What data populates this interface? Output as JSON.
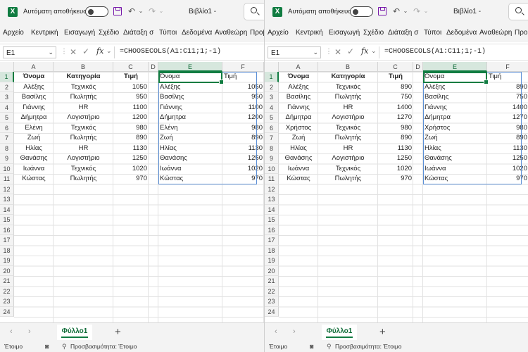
{
  "app": {
    "autosave_label": "Αυτόματη αποθήκευση",
    "doc_title": "Βιβλίο1  -",
    "logo_letter": "X"
  },
  "menu": [
    "Αρχείο",
    "Κεντρική",
    "Εισαγωγή",
    "Σχέδιο",
    "Διάταξη σ",
    "Τύποι",
    "Δεδομένα",
    "Αναθεώρη",
    "Προβ"
  ],
  "formula_bar": {
    "name_box": "E1",
    "formula": "=CHOOSECOLS(A1:C11;1;-1)",
    "fx": "fx"
  },
  "columns": [
    "A",
    "B",
    "C",
    "D",
    "E",
    "F"
  ],
  "rows": [
    "1",
    "2",
    "3",
    "4",
    "5",
    "6",
    "7",
    "8",
    "9",
    "10",
    "11",
    "12",
    "13",
    "14",
    "15",
    "16",
    "17",
    "18",
    "19",
    "20",
    "21",
    "22",
    "23",
    "24"
  ],
  "windows": [
    {
      "headers": [
        "Όνομα",
        "Κατηγορία",
        "Τιμή"
      ],
      "source": [
        [
          "Αλέξης",
          "Τεχνικός",
          "1050"
        ],
        [
          "Βασίλης",
          "Πωλητής",
          "950"
        ],
        [
          "Γιάννης",
          "HR",
          "1100"
        ],
        [
          "Δήμητρα",
          "Λογιστήριο",
          "1200"
        ],
        [
          "Ελένη",
          "Τεχνικός",
          "980"
        ],
        [
          "Ζωή",
          "Πωλητής",
          "890"
        ],
        [
          "Ηλίας",
          "HR",
          "1130"
        ],
        [
          "Θανάσης",
          "Λογιστήριο",
          "1250"
        ],
        [
          "Ιωάννα",
          "Τεχνικός",
          "1020"
        ],
        [
          "Κώστας",
          "Πωλητής",
          "970"
        ]
      ],
      "result_headers": [
        "Όνομα",
        "Τιμή"
      ],
      "result": [
        [
          "Αλέξης",
          "1050"
        ],
        [
          "Βασίλης",
          "950"
        ],
        [
          "Γιάννης",
          "1100"
        ],
        [
          "Δήμητρα",
          "1200"
        ],
        [
          "Ελένη",
          "980"
        ],
        [
          "Ζωή",
          "890"
        ],
        [
          "Ηλίας",
          "1130"
        ],
        [
          "Θανάσης",
          "1250"
        ],
        [
          "Ιωάννα",
          "1020"
        ],
        [
          "Κώστας",
          "970"
        ]
      ]
    },
    {
      "headers": [
        "Όνομα",
        "Κατηγορία",
        "Τιμή"
      ],
      "source": [
        [
          "Αλέξης",
          "Τεχνικός",
          "890"
        ],
        [
          "Βασίλης",
          "Πωλητής",
          "750"
        ],
        [
          "Γιάννης",
          "HR",
          "1400"
        ],
        [
          "Δήμητρα",
          "Λογιστήριο",
          "1270"
        ],
        [
          "Χρήστος",
          "Τεχνικός",
          "980"
        ],
        [
          "Ζωή",
          "Πωλητής",
          "890"
        ],
        [
          "Ηλίας",
          "HR",
          "1130"
        ],
        [
          "Θανάσης",
          "Λογιστήριο",
          "1250"
        ],
        [
          "Ιωάννα",
          "Τεχνικός",
          "1020"
        ],
        [
          "Κώστας",
          "Πωλητής",
          "970"
        ]
      ],
      "result_headers": [
        "Όνομα",
        "Τιμή"
      ],
      "result": [
        [
          "Αλέξης",
          "890"
        ],
        [
          "Βασίλης",
          "750"
        ],
        [
          "Γιάννης",
          "1400"
        ],
        [
          "Δήμητρα",
          "1270"
        ],
        [
          "Χρήστος",
          "980"
        ],
        [
          "Ζωή",
          "890"
        ],
        [
          "Ηλίας",
          "1130"
        ],
        [
          "Θανάσης",
          "1250"
        ],
        [
          "Ιωάννα",
          "1020"
        ],
        [
          "Κώστας",
          "970"
        ]
      ]
    }
  ],
  "sheet_tab": "Φύλλο1",
  "status": {
    "ready": "Έτοιμο",
    "accessibility": "Προσβασιμότητα: Έτοιμο"
  },
  "icons": {
    "logo": "excel-logo-icon",
    "save": "save-icon",
    "undo": "undo-icon",
    "redo": "redo-icon",
    "search": "search-icon",
    "add_sheet": "add-sheet-icon",
    "accessibility": "accessibility-icon"
  },
  "colors": {
    "accent": "#107c41",
    "save_icon": "#7719aa",
    "spill_border": "#5b8fd6"
  }
}
